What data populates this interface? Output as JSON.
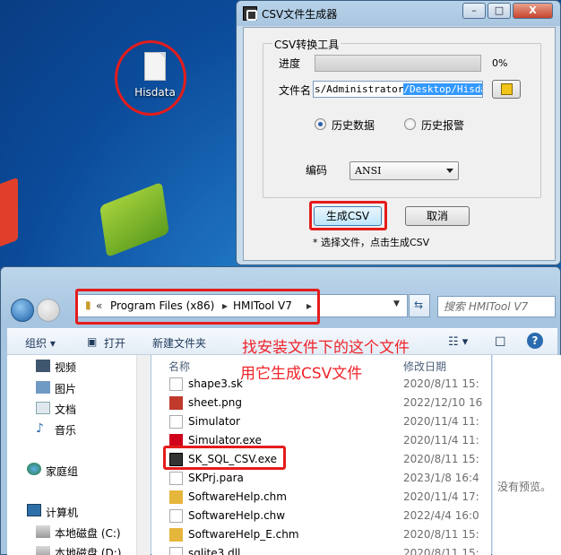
{
  "desktop": {
    "icon_label": "Hisdata"
  },
  "csv_dialog": {
    "title": "CSV文件生成器",
    "group_title": "CSV转换工具",
    "progress_label": "进度",
    "progress_value": 0,
    "progress_text": "0%",
    "file_label": "文件名",
    "path_value_plain": "s/Administrator",
    "path_value_selected": "/Desktop/Hisdata",
    "radio_history_data": "历史数据",
    "radio_history_alarm": "历史报警",
    "encoding_label": "编码",
    "encoding_value": "ANSI",
    "generate_button": "生成CSV",
    "cancel_button": "取消",
    "hint": "* 选择文件，点击生成CSV",
    "caption_minimize": "–",
    "caption_maximize": "□",
    "caption_close": "X"
  },
  "explorer": {
    "breadcrumb_prefix": "«",
    "breadcrumb_1": "Program Files (x86)",
    "breadcrumb_sep": "▸",
    "breadcrumb_2": "HMITool V7",
    "search_placeholder": "搜索 HMITool V7",
    "toolbar": {
      "organize": "组织 ▾",
      "open": "打开",
      "new_folder": "新建文件夹"
    },
    "nav": [
      {
        "label": "视频"
      },
      {
        "label": "图片"
      },
      {
        "label": "文档"
      },
      {
        "label": "音乐"
      },
      {
        "label": "家庭组"
      },
      {
        "label": "计算机"
      },
      {
        "label": "本地磁盘 (C:)"
      },
      {
        "label": "本地磁盘 (D:)"
      }
    ],
    "columns": {
      "name": "名称",
      "date": "修改日期"
    },
    "files": [
      {
        "name": "shape3.sk",
        "date": "2020/8/11 15:"
      },
      {
        "name": "sheet.png",
        "date": "2022/12/10 16"
      },
      {
        "name": "Simulator",
        "date": "2020/11/4 11:"
      },
      {
        "name": "Simulator.exe",
        "date": "2020/11/4 11:"
      },
      {
        "name": "SK_SQL_CSV.exe",
        "date": "2020/8/11 15:"
      },
      {
        "name": "SKPrj.para",
        "date": "2023/1/8 16:4"
      },
      {
        "name": "SoftwareHelp.chm",
        "date": "2020/11/4 17:"
      },
      {
        "name": "SoftwareHelp.chw",
        "date": "2022/4/4 16:0"
      },
      {
        "name": "SoftwareHelp_E.chm",
        "date": "2020/8/11 15:"
      },
      {
        "name": "sqlite3.dll",
        "date": "2020/8/11 15:"
      }
    ],
    "preview_text": "没有预览。"
  },
  "annotation": {
    "line1": "找安装文件下的这个文件",
    "line2": "用它生成CSV文件"
  },
  "colors": {
    "annotation_red": "#e41c1c",
    "selection_blue": "#3399ff"
  }
}
